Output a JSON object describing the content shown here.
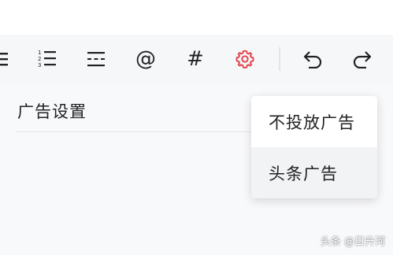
{
  "toolbar": {
    "buttons": [
      {
        "icon": "list-icon"
      },
      {
        "icon": "ordered-list-icon",
        "numbers": [
          "1",
          "2",
          "3"
        ]
      },
      {
        "icon": "horizontal-rule-icon"
      },
      {
        "icon": "at-sign-icon",
        "glyph": "@"
      },
      {
        "icon": "hashtag-icon",
        "glyph": "#"
      },
      {
        "icon": "gear-icon",
        "active": true
      },
      {
        "icon": "undo-icon"
      },
      {
        "icon": "redo-icon"
      }
    ],
    "accent_color": "#e0464e"
  },
  "section": {
    "title": "广告设置"
  },
  "menu": {
    "items": [
      {
        "label": "不投放广告",
        "highlighted": false
      },
      {
        "label": "头条广告",
        "highlighted": true
      }
    ]
  },
  "watermark": {
    "text": "头条 @日升河"
  }
}
